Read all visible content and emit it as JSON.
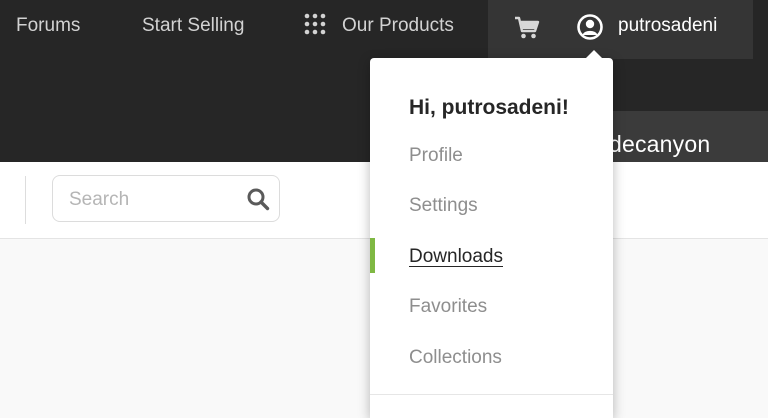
{
  "nav": {
    "forums": "Forums",
    "start_selling": "Start Selling",
    "our_products": "Our Products"
  },
  "account": {
    "username": "putrosadeni"
  },
  "brand": {
    "text": "odecanyon"
  },
  "search": {
    "placeholder": "Search"
  },
  "dropdown": {
    "greeting": "Hi, putrosadeni!",
    "items": [
      {
        "label": "Profile",
        "active": false
      },
      {
        "label": "Settings",
        "active": false
      },
      {
        "label": "Downloads",
        "active": true
      },
      {
        "label": "Favorites",
        "active": false
      },
      {
        "label": "Collections",
        "active": false
      }
    ]
  },
  "colors": {
    "topbar": "#262626",
    "account_box": "#353535",
    "active_marker": "#7fb843"
  },
  "icons": {
    "grid": "grid-dots-icon",
    "cart": "cart-icon",
    "user": "user-circle-icon",
    "search": "search-icon"
  }
}
